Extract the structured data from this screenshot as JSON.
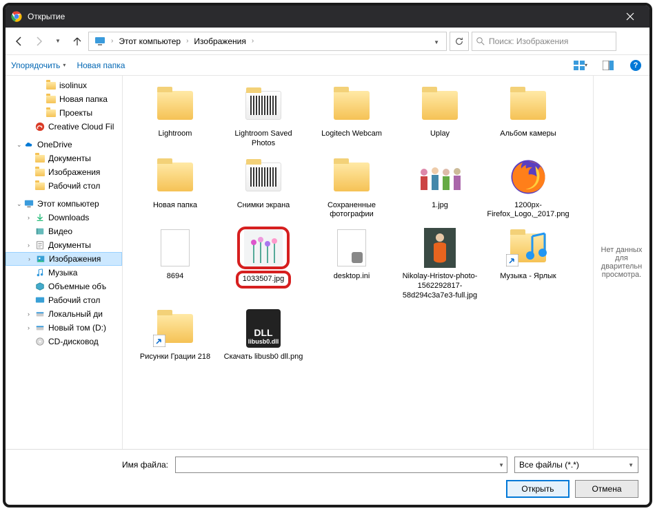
{
  "window": {
    "title": "Открытие"
  },
  "breadcrumb": {
    "root": "Этот компьютер",
    "current": "Изображения"
  },
  "search": {
    "placeholder": "Поиск: Изображения"
  },
  "toolbar": {
    "organize": "Упорядочить",
    "newfolder": "Новая папка"
  },
  "tree": {
    "isolinux": "isolinux",
    "novaya": "Новая папка",
    "proekty": "Проекты",
    "ccf": "Creative Cloud Fil",
    "onedrive": "OneDrive",
    "od_docs": "Документы",
    "od_pics": "Изображения",
    "od_desk": "Рабочий стол",
    "thispc": "Этот компьютер",
    "downloads": "Downloads",
    "video": "Видео",
    "docs": "Документы",
    "pics": "Изображения",
    "music": "Музыка",
    "volobj": "Объемные объ",
    "desk": "Рабочий стол",
    "localc": "Локальный ди",
    "newtomd": "Новый том (D:)",
    "cd": "CD-дисковод"
  },
  "files": [
    {
      "name": "Lightroom",
      "type": "folder"
    },
    {
      "name": "Lightroom Saved Photos",
      "type": "folder-thumb"
    },
    {
      "name": "Logitech Webcam",
      "type": "folder"
    },
    {
      "name": "Uplay",
      "type": "folder"
    },
    {
      "name": "Альбом камеры",
      "type": "folder"
    },
    {
      "name": "Новая папка",
      "type": "folder"
    },
    {
      "name": "Снимки экрана",
      "type": "folder-thumb"
    },
    {
      "name": "Сохраненные фотографии",
      "type": "folder"
    },
    {
      "name": "1.jpg",
      "type": "image-people"
    },
    {
      "name": "1200px-Firefox_Logo,_2017.png",
      "type": "firefox"
    },
    {
      "name": "8694",
      "type": "blank"
    },
    {
      "name": "1033507.jpg",
      "type": "image-flowers",
      "highlight": true
    },
    {
      "name": "desktop.ini",
      "type": "ini"
    },
    {
      "name": "Nikolay-Hristov-photo-1562292817-58d294c3a7e3-full.jpg",
      "type": "image-orange"
    },
    {
      "name": "Музыка - Ярлык",
      "type": "music-shortcut"
    },
    {
      "name": "Рисунки Грации 218",
      "type": "folder-shortcut"
    },
    {
      "name": "Скачать libusb0 dll.png",
      "type": "dll"
    }
  ],
  "preview": {
    "text": "Нет данных для дварительн просмотра."
  },
  "footer": {
    "filename_label": "Имя файла:",
    "filter": "Все файлы (*.*)",
    "open": "Открыть",
    "cancel": "Отмена"
  }
}
